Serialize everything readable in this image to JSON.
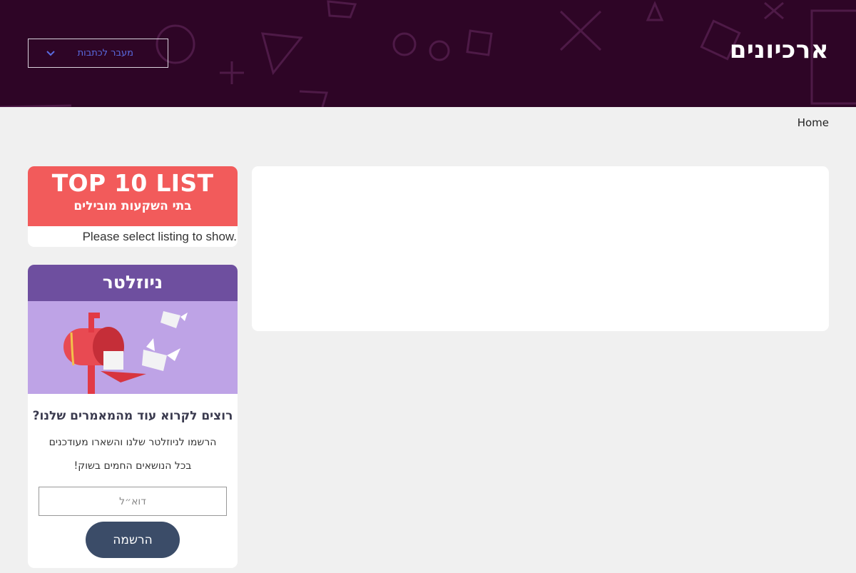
{
  "header": {
    "title": "ארכיונים",
    "jump_label": "מעבר לכתבות",
    "background": "#2e0526"
  },
  "breadcrumb": {
    "home": "Home"
  },
  "top10": {
    "title": "TOP 10 LIST",
    "subtitle": "בתי השקעות מובילים",
    "message": "Please select listing to show.",
    "accent": "#f25b5b"
  },
  "newsletter": {
    "title": "ניוזלטר",
    "question": "רוצים לקרוא עוד מהמאמרים שלנו?",
    "line1": "הרשמו לניוזלטר שלנו והשארו מעודכנים",
    "line2": "בכל הנושאים החמים בשוק!",
    "email_placeholder": "דוא״ל",
    "submit_label": "הרשמה",
    "accent": "#6e4f9f",
    "button_color": "#3b4c68"
  }
}
